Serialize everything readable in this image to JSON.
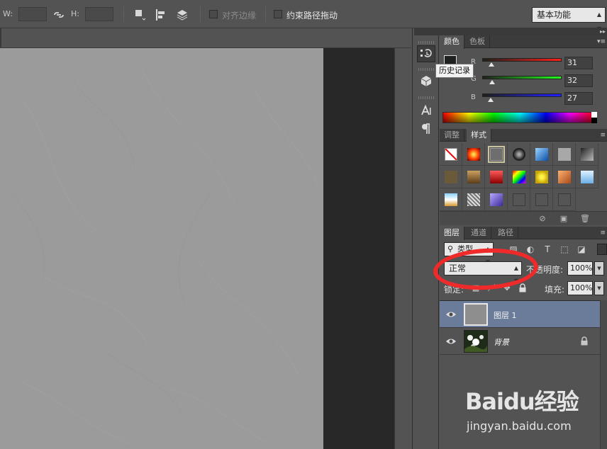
{
  "options_bar": {
    "w_label": "W:",
    "h_label": "H:",
    "align_edges_label": "对齐边缘",
    "constrain_path_label": "约束路径拖动",
    "workspace": "基本功能"
  },
  "tooltip": "历史记录",
  "color_panel": {
    "tabs": [
      "颜色",
      "色板"
    ],
    "r_label": "R",
    "g_label": "G",
    "b_label": "B",
    "r_value": "31",
    "g_value": "32",
    "b_value": "27",
    "r": 31,
    "g": 32,
    "b": 27,
    "foreground_color": "#1f201b"
  },
  "styles_panel": {
    "tabs": [
      "调整",
      "样式"
    ]
  },
  "layers_panel": {
    "tabs": [
      "图层",
      "通道",
      "路径"
    ],
    "filter_kind": "类型",
    "blend_mode": "正常",
    "opacity_label": "不透明度:",
    "opacity_value": "100%",
    "lock_label": "锁定:",
    "fill_label": "填充:",
    "fill_value": "100%",
    "layers": [
      {
        "name": "图层 1",
        "selected": true
      },
      {
        "name": "背景",
        "selected": false,
        "locked": true
      }
    ]
  },
  "watermark": {
    "logo": "Baidu经验",
    "url": "jingyan.baidu.com"
  },
  "colors": {
    "annotation": "#ee2a2a",
    "selected_layer": "#6a7c99",
    "canvas": "#9b9b9b"
  }
}
